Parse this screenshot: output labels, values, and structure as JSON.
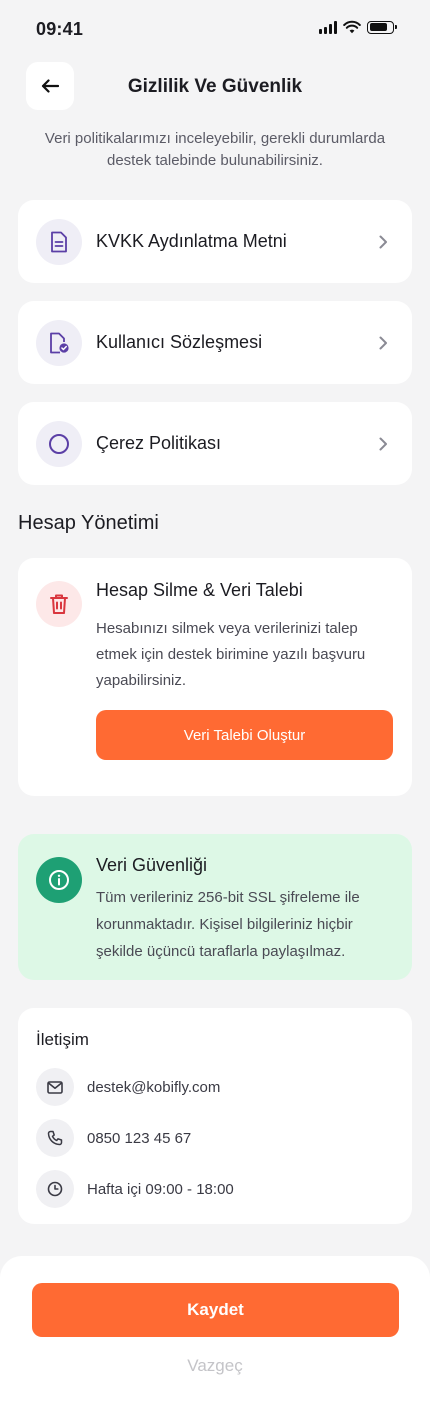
{
  "status_bar": {
    "time": "09:41"
  },
  "header": {
    "title": "Gizlilik Ve Güvenlik",
    "subtitle": "Veri politikalarımızı inceleyebilir, gerekli durumlarda destek talebinde bulunabilirsiniz."
  },
  "menu": {
    "items": [
      {
        "label": "KVKK Aydınlatma Metni",
        "icon": "document-icon"
      },
      {
        "label": "Kullanıcı Sözleşmesi",
        "icon": "document-check-icon"
      },
      {
        "label": "Çerez Politikası",
        "icon": "circle-icon"
      }
    ]
  },
  "account": {
    "section_title": "Hesap Yönetimi",
    "delete_title": "Hesap Silme & Veri Talebi",
    "delete_description": "Hesabınızı silmek veya verilerinizi talep etmek için destek birimine yazılı başvuru yapabilirsiniz.",
    "request_button": "Veri Talebi Oluştur"
  },
  "security": {
    "title": "Veri Güvenliği",
    "description": "Tüm verileriniz 256-bit SSL şifreleme ile korunmaktadır. Kişisel bilgileriniz hiçbir şekilde üçüncü taraflarla paylaşılmaz."
  },
  "contact": {
    "title": "İletişim",
    "email": "destek@kobifly.com",
    "phone": "0850 123 45 67",
    "hours": "Hafta içi 09:00 - 18:00"
  },
  "actions": {
    "save": "Kaydet",
    "cancel": "Vazgeç"
  },
  "colors": {
    "accent": "#ff6a33",
    "icon_purple": "#5b3fa6",
    "danger": "#d9363e",
    "success": "#1ea074",
    "success_bg": "#ddf8e6"
  }
}
